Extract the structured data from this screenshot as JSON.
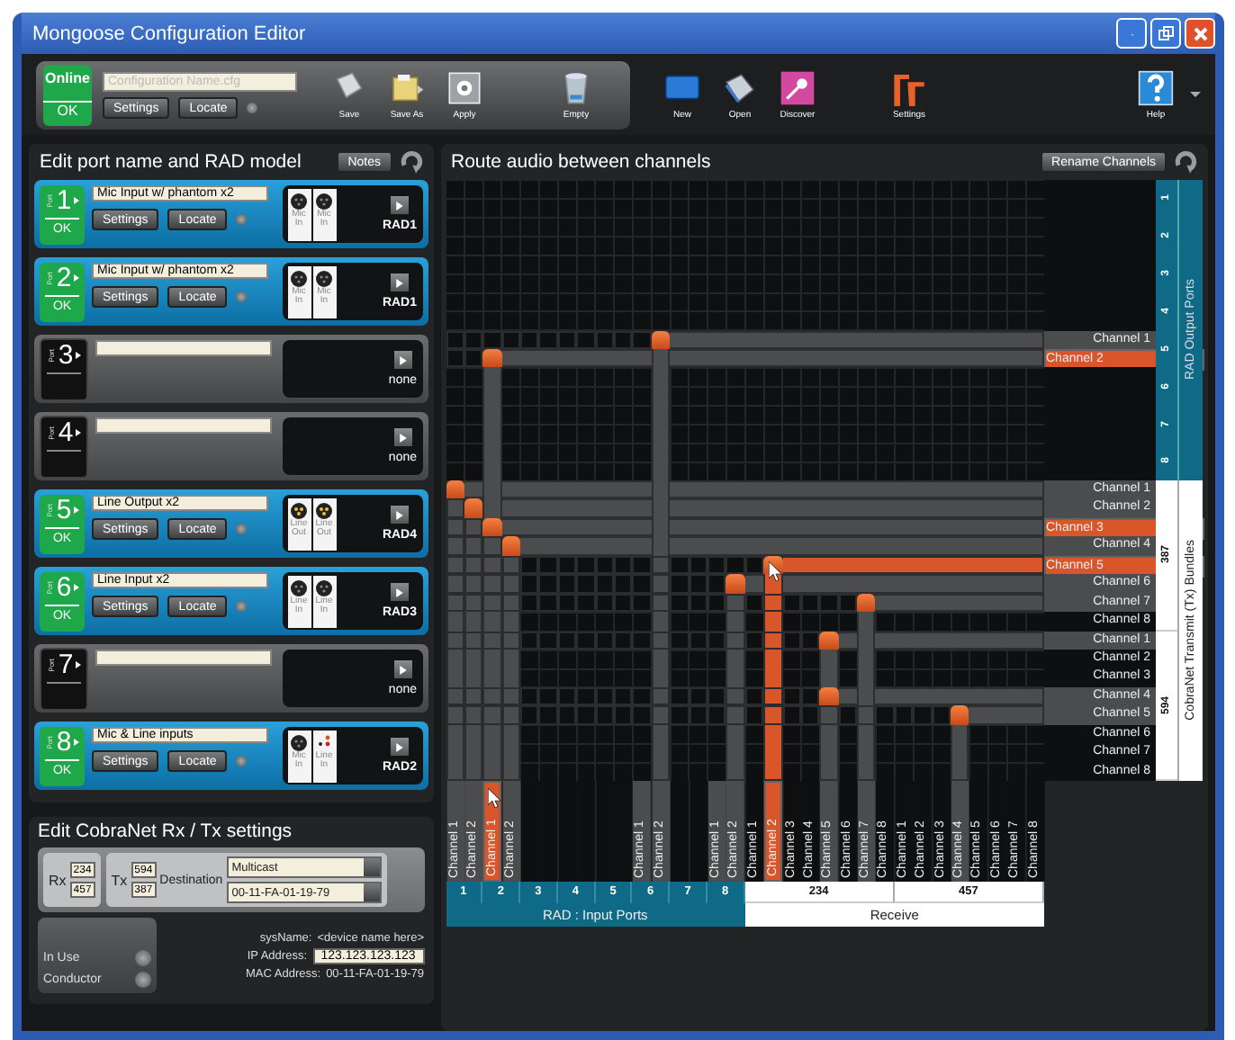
{
  "window": {
    "title": "Mongoose Configuration Editor"
  },
  "toolbar": {
    "status": {
      "label": "Online",
      "value": "OK"
    },
    "config_field": {
      "placeholder": "Configuration Name.cfg"
    },
    "buttons": [
      "Settings",
      "Locate"
    ],
    "groups": [
      [
        {
          "kind": "save",
          "label": "Save"
        },
        {
          "kind": "saveas",
          "label": "Save As"
        },
        {
          "kind": "apply",
          "label": "Apply"
        },
        {
          "kind": "empty",
          "label": "Empty"
        }
      ],
      [
        {
          "kind": "new",
          "label": "New"
        },
        {
          "kind": "open",
          "label": "Open"
        },
        {
          "kind": "discover",
          "label": "Discover"
        },
        {
          "kind": "settings",
          "label": "Settings"
        }
      ],
      [
        {
          "kind": "help",
          "label": "Help"
        }
      ]
    ]
  },
  "ports_panel": {
    "title": "Edit port name and RAD model",
    "notes_button": "Notes",
    "ports": [
      {
        "number": "1",
        "port_label": "Port",
        "configured": true,
        "status": "OK",
        "name": "Mic Input w/ phantom x2",
        "buttons": [
          "Settings",
          "Locate"
        ],
        "jacks": [
          {
            "kind": "xlr-female",
            "label": "Mic In"
          },
          {
            "kind": "xlr-female",
            "label": "Mic In"
          }
        ],
        "model": "RAD1"
      },
      {
        "number": "2",
        "port_label": "Port",
        "configured": true,
        "status": "OK",
        "name": "Mic Input w/ phantom x2",
        "buttons": [
          "Settings",
          "Locate"
        ],
        "jacks": [
          {
            "kind": "xlr-female",
            "label": "Mic In"
          },
          {
            "kind": "xlr-female",
            "label": "Mic In"
          }
        ],
        "model": "RAD1"
      },
      {
        "number": "3",
        "port_label": "Port",
        "configured": false,
        "model": "none"
      },
      {
        "number": "4",
        "port_label": "Port",
        "configured": false,
        "model": "none"
      },
      {
        "number": "5",
        "port_label": "Port",
        "configured": true,
        "status": "OK",
        "name": "Line Output x2",
        "buttons": [
          "Settings",
          "Locate"
        ],
        "jacks": [
          {
            "kind": "xlr-male",
            "label": "Line Out"
          },
          {
            "kind": "xlr-male",
            "label": "Line Out"
          }
        ],
        "model": "RAD4"
      },
      {
        "number": "6",
        "port_label": "Port",
        "configured": true,
        "status": "OK",
        "name": "Line Input x2",
        "buttons": [
          "Settings",
          "Locate"
        ],
        "jacks": [
          {
            "kind": "xlr-female",
            "label": "Line In"
          },
          {
            "kind": "xlr-female",
            "label": "Line In"
          }
        ],
        "model": "RAD3"
      },
      {
        "number": "7",
        "port_label": "Port",
        "configured": false,
        "model": "none"
      },
      {
        "number": "8",
        "port_label": "Port",
        "configured": true,
        "status": "OK",
        "name": "Mic & Line inputs",
        "buttons": [
          "Settings",
          "Locate"
        ],
        "jacks": [
          {
            "kind": "xlr-female",
            "label": "Mic In"
          },
          {
            "kind": "rca",
            "label": "Line In"
          }
        ],
        "model": "RAD2"
      }
    ]
  },
  "cobranet": {
    "title": "Edit CobraNet Rx / Tx settings",
    "rx": {
      "label": "Rx",
      "values": [
        "234",
        "457"
      ]
    },
    "tx": {
      "label": "Tx",
      "values": [
        "594",
        "387"
      ]
    },
    "destination": {
      "label": "Destination",
      "values": [
        "Multicast",
        "00-11-FA-01-19-79"
      ]
    },
    "indicators": [
      "In Use",
      "Conductor"
    ],
    "info": [
      {
        "kind": "text",
        "label": "sysName:",
        "value": "<device name here>"
      },
      {
        "kind": "field",
        "label": "IP Address:",
        "value": "123.123.123.123"
      },
      {
        "kind": "text",
        "label": "MAC Address:",
        "value": "00-11-FA-01-19-79"
      }
    ]
  },
  "routing": {
    "title": "Route audio between channels",
    "rename_button": "Rename Channels",
    "outputs": {
      "title": "RAD Output Ports",
      "groups": [
        {
          "label": "1",
          "rows": [
            {
              "selected": false
            },
            {
              "selected": false
            }
          ]
        },
        {
          "label": "2",
          "rows": [
            {
              "selected": false
            },
            {
              "selected": false
            }
          ]
        },
        {
          "label": "3",
          "rows": [
            {
              "selected": false
            },
            {
              "selected": false
            }
          ]
        },
        {
          "label": "4",
          "rows": [
            {
              "selected": false
            },
            {
              "selected": false
            }
          ]
        },
        {
          "label": "5",
          "rows": [
            {
              "label": "Channel 1",
              "selected": false,
              "routes": [
                false,
                false,
                false,
                false,
                false,
                false,
                false,
                false,
                false,
                false,
                false,
                true
              ]
            },
            {
              "label": "Channel 2",
              "selected": true,
              "routes": [
                false,
                false,
                true
              ]
            }
          ]
        },
        {
          "label": "6",
          "rows": [
            {
              "selected": false
            },
            {
              "selected": false
            }
          ]
        },
        {
          "label": "7",
          "rows": [
            {
              "selected": false
            },
            {
              "selected": false
            }
          ]
        },
        {
          "label": "8",
          "rows": [
            {
              "selected": false
            },
            {
              "selected": false
            }
          ]
        }
      ]
    },
    "transmit": {
      "title": "CobraNet Transmit (Tx) Bundles",
      "groups": [
        {
          "label": "387",
          "rows": [
            {
              "label": "Channel 1",
              "selected": false,
              "routes": [
                true
              ]
            },
            {
              "label": "Channel 2",
              "selected": false,
              "routes": [
                false,
                true
              ]
            },
            {
              "label": "Channel 3",
              "selected": true,
              "routes": [
                false,
                false,
                true
              ]
            },
            {
              "label": "Channel 4",
              "selected": false,
              "routes": [
                false,
                false,
                false,
                true
              ]
            },
            {
              "label": "Channel 5",
              "selected": true,
              "hovered": true,
              "routes": [
                false,
                false,
                false,
                false,
                false,
                false,
                false,
                false,
                false,
                false,
                false,
                false,
                false,
                false,
                false,
                false,
                false,
                true
              ]
            },
            {
              "label": "Channel 6",
              "selected": false,
              "routes": [
                false,
                false,
                false,
                false,
                false,
                false,
                false,
                false,
                false,
                false,
                false,
                false,
                false,
                false,
                false,
                true
              ]
            },
            {
              "label": "Channel 7",
              "selected": false,
              "routes": [
                false,
                false,
                false,
                false,
                false,
                false,
                false,
                false,
                false,
                false,
                false,
                false,
                false,
                false,
                false,
                false,
                false,
                false,
                false,
                false,
                false,
                false,
                true
              ]
            },
            {
              "label": "Channel 8",
              "selected": false
            }
          ]
        },
        {
          "label": "594",
          "rows": [
            {
              "label": "Channel 1",
              "selected": false,
              "routes": [
                false,
                false,
                false,
                false,
                false,
                false,
                false,
                false,
                false,
                false,
                false,
                false,
                false,
                false,
                false,
                false,
                false,
                false,
                false,
                false,
                true
              ]
            },
            {
              "label": "Channel 2",
              "selected": false
            },
            {
              "label": "Channel 3",
              "selected": false
            },
            {
              "label": "Channel 4",
              "selected": false,
              "routes": [
                false,
                false,
                false,
                false,
                false,
                false,
                false,
                false,
                false,
                false,
                false,
                false,
                false,
                false,
                false,
                false,
                false,
                false,
                false,
                false,
                true
              ]
            },
            {
              "label": "Channel 5",
              "selected": false,
              "routes": [
                false,
                false,
                false,
                false,
                false,
                false,
                false,
                false,
                false,
                false,
                false,
                false,
                false,
                false,
                false,
                false,
                false,
                false,
                false,
                false,
                false,
                false,
                false,
                false,
                false,
                false,
                false,
                true
              ]
            },
            {
              "label": "Channel 6",
              "selected": false
            },
            {
              "label": "Channel 7",
              "selected": false
            },
            {
              "label": "Channel 8",
              "selected": false
            }
          ]
        }
      ]
    },
    "inputs": {
      "title": "RAD : Input Ports",
      "groups": [
        {
          "label": "1",
          "columns": [
            {
              "label": "Channel 1",
              "selected": false,
              "highlighted": true
            },
            {
              "label": "Channel 2",
              "selected": false,
              "highlighted": true
            }
          ]
        },
        {
          "label": "2",
          "columns": [
            {
              "label": "Channel 1",
              "selected": true,
              "highlighted": true
            },
            {
              "label": "Channel 2",
              "selected": false,
              "highlighted": true
            }
          ]
        },
        {
          "label": "3",
          "columns": [
            {
              "selected": false,
              "highlighted": false
            },
            {
              "selected": false,
              "highlighted": false
            }
          ]
        },
        {
          "label": "4",
          "columns": [
            {
              "selected": false,
              "highlighted": false
            },
            {
              "selected": false,
              "highlighted": false
            }
          ]
        },
        {
          "label": "5",
          "columns": [
            {
              "selected": false,
              "highlighted": false
            },
            {
              "selected": false,
              "highlighted": false
            }
          ]
        },
        {
          "label": "6",
          "columns": [
            {
              "label": "Channel 1",
              "selected": false,
              "highlighted": true
            },
            {
              "label": "Channel 2",
              "selected": false,
              "highlighted": true
            }
          ]
        },
        {
          "label": "7",
          "columns": [
            {
              "selected": false,
              "highlighted": false
            },
            {
              "selected": false,
              "highlighted": false
            }
          ]
        },
        {
          "label": "8",
          "columns": [
            {
              "label": "Channel 1",
              "selected": false,
              "highlighted": true
            },
            {
              "label": "Channel 2",
              "selected": false,
              "highlighted": true
            }
          ]
        }
      ]
    },
    "receive": {
      "title": "Receive",
      "groups": [
        {
          "label": "234",
          "columns": [
            {
              "label": "Channel 1",
              "selected": false,
              "highlighted": false
            },
            {
              "label": "Channel 2",
              "selected": true,
              "highlighted": true
            },
            {
              "label": "Channel 3",
              "selected": false,
              "highlighted": false
            },
            {
              "label": "Channel 4",
              "selected": false,
              "highlighted": false
            },
            {
              "label": "Channel 5",
              "selected": false,
              "highlighted": true
            },
            {
              "label": "Channel 6",
              "selected": false,
              "highlighted": false
            },
            {
              "label": "Channel 7",
              "selected": false,
              "highlighted": true
            },
            {
              "label": "Channel 8",
              "selected": false,
              "highlighted": false
            }
          ]
        },
        {
          "label": "457",
          "columns": [
            {
              "label": "Channel 1",
              "selected": false,
              "highlighted": false
            },
            {
              "label": "Channel 2",
              "selected": false,
              "highlighted": false
            },
            {
              "label": "Channel 3",
              "selected": false,
              "highlighted": false
            },
            {
              "label": "Channel 4",
              "selected": false,
              "highlighted": true
            },
            {
              "label": "Channel 5",
              "selected": false,
              "highlighted": false
            },
            {
              "label": "Channel 6",
              "selected": false,
              "highlighted": false
            },
            {
              "label": "Channel 7",
              "selected": false,
              "highlighted": false
            },
            {
              "label": "Channel 8",
              "selected": false,
              "highlighted": false
            }
          ]
        }
      ]
    }
  }
}
